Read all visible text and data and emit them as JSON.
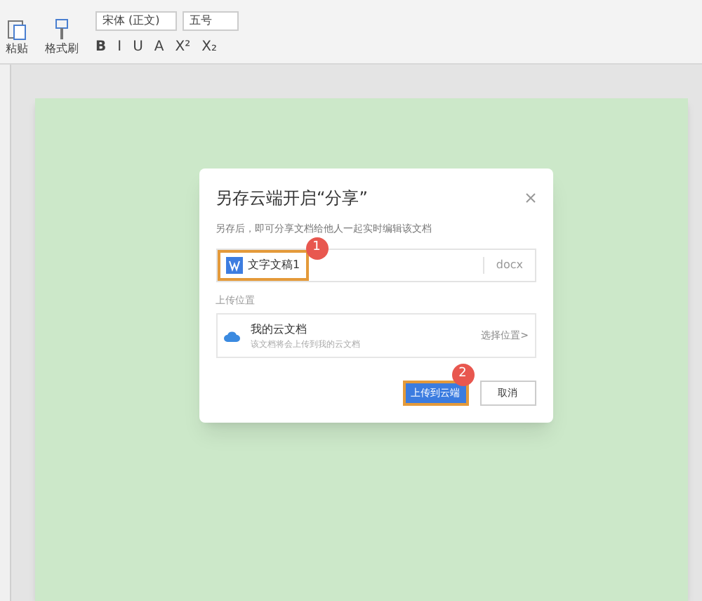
{
  "toolbar": {
    "paste_label": "粘贴",
    "format_painter_label": "格式刷",
    "font": "宋体 (正文)",
    "size": "五号",
    "format_buttons": [
      "B",
      "I",
      "U",
      "A",
      "X²",
      "X₂"
    ]
  },
  "dialog": {
    "title": "另存云端开启“分享”",
    "subtitle": "另存后，即可分享文档给他人一起实时编辑该文档",
    "file_name": "文字文稿1",
    "extension": "docx",
    "location_label": "上传位置",
    "location": {
      "name": "我的云文档",
      "description": "该文档将会上传到我的云文档",
      "action": "选择位置>"
    },
    "buttons": [
      {
        "label": "上传到云端",
        "kind": "primary"
      },
      {
        "label": "取消",
        "kind": "secondary"
      }
    ],
    "steps": [
      {
        "number": "1"
      },
      {
        "number": "2"
      }
    ]
  }
}
